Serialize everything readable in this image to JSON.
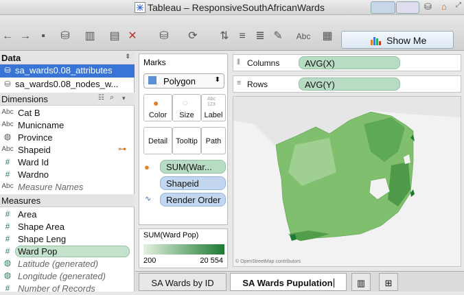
{
  "window": {
    "title": "Tableau – ResponsiveSouthAfricanWards"
  },
  "toolbar": {
    "show_me": "Show Me",
    "abc": "Abc"
  },
  "data_pane": {
    "header": "Data",
    "sources": [
      "sa_wards0.08_attributes",
      "sa_wards0.08_nodes_w..."
    ],
    "dimensions_header": "Dimensions",
    "dimensions": [
      {
        "type": "Abc",
        "label": "Cat B"
      },
      {
        "type": "Abc",
        "label": "Municname"
      },
      {
        "type": "globe",
        "label": "Province"
      },
      {
        "type": "Abc",
        "label": "Shapeid"
      },
      {
        "type": "#",
        "label": "Ward Id"
      },
      {
        "type": "#",
        "label": "Wardno"
      },
      {
        "type": "Abc",
        "label": "Measure Names"
      }
    ],
    "measures_header": "Measures",
    "measures": [
      {
        "type": "#",
        "label": "Area"
      },
      {
        "type": "#",
        "label": "Shape Area"
      },
      {
        "type": "#",
        "label": "Shape Leng"
      },
      {
        "type": "#",
        "label": "Ward Pop"
      },
      {
        "type": "globe",
        "label": "Latitude (generated)"
      },
      {
        "type": "globe",
        "label": "Longitude (generated)"
      },
      {
        "type": "#",
        "label": "Number of Records"
      }
    ]
  },
  "marks": {
    "header": "Marks",
    "type": "Polygon",
    "buttons": [
      "Color",
      "Size",
      "Label",
      "Detail",
      "Tooltip",
      "Path"
    ],
    "label_icon_text": "Abc\n123",
    "pills": [
      "SUM(War...",
      "Shapeid",
      "Render Order"
    ]
  },
  "legend": {
    "title": "SUM(Ward Pop)",
    "min": "200",
    "max": "20 554",
    "color_low": "#e3f1e0",
    "color_high": "#1e7a33"
  },
  "shelves": {
    "columns_label": "Columns",
    "columns_value": "AVG(X)",
    "rows_label": "Rows",
    "rows_value": "AVG(Y)"
  },
  "map": {
    "attribution": "© OpenStreetMap contributors",
    "fill": "#7fbf6e"
  },
  "tabs": [
    "SA Wards by ID",
    "SA Wards Pupulation"
  ]
}
